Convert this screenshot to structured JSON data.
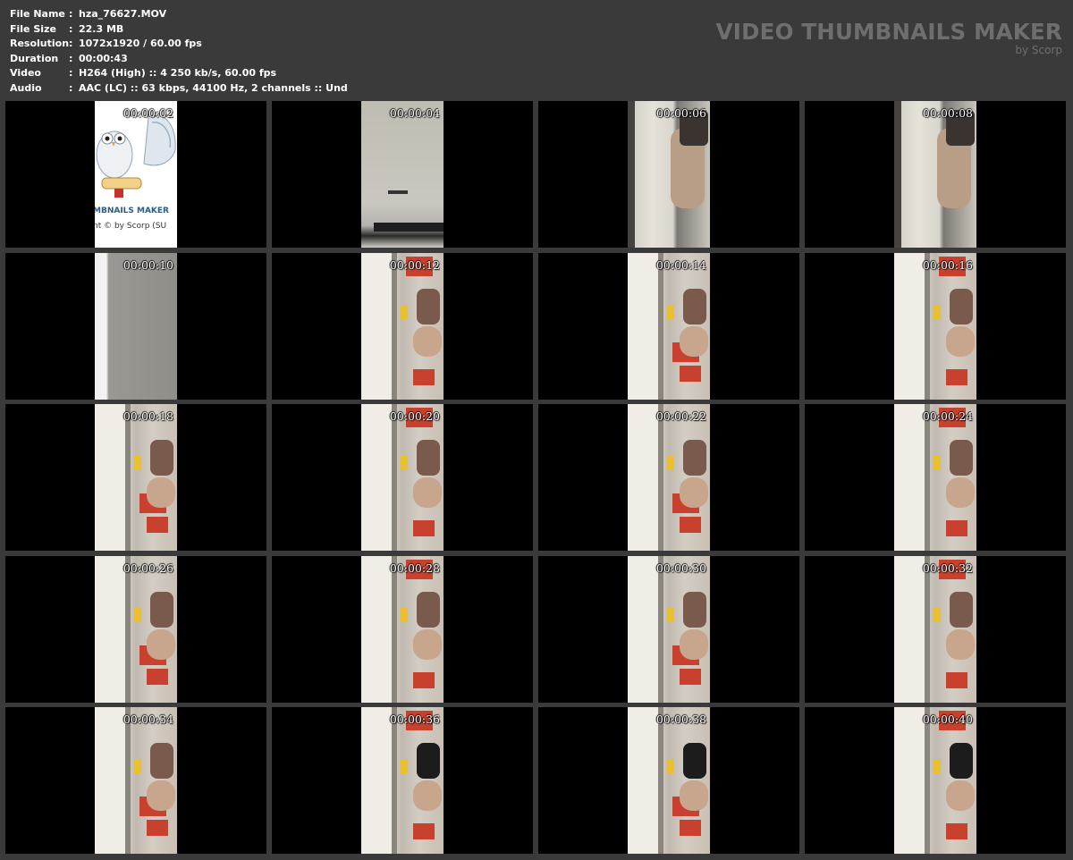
{
  "file_info": {
    "file_name": {
      "label": "File Name",
      "sep": ":",
      "value": "hza_76627.MOV"
    },
    "file_size": {
      "label": "File Size",
      "sep": ":",
      "value": "22.3 MB"
    },
    "resolution": {
      "label": "Resolution",
      "sep": ":",
      "value": "1072x1920 / 60.00 fps"
    },
    "duration": {
      "label": "Duration",
      "sep": ":",
      "value": "00:00:43"
    },
    "video": {
      "label": "Video",
      "sep": ":",
      "value": "H264 (High) :: 4 250 kb/s, 60.00 fps"
    },
    "audio": {
      "label": "Audio",
      "sep": ":",
      "value": "AAC (LC) :: 63 kbps, 44100 Hz, 2 channels :: Und"
    }
  },
  "brand": {
    "title": "VIDEO THUMBNAILS MAKER",
    "subtitle": "by Scorp"
  },
  "splash": {
    "text1": "MBNAILS MAKER",
    "text2": "nt © by Scorp (SU"
  },
  "thumbnails": [
    {
      "time": "00:00:02",
      "scene": "splash"
    },
    {
      "time": "00:00:04",
      "scene": "ceiling"
    },
    {
      "time": "00:00:06",
      "scene": "wall"
    },
    {
      "time": "00:00:08",
      "scene": "wall"
    },
    {
      "time": "00:00:10",
      "scene": "gray"
    },
    {
      "time": "00:00:12",
      "scene": "scene"
    },
    {
      "time": "00:00:14",
      "scene": "scene"
    },
    {
      "time": "00:00:16",
      "scene": "scene"
    },
    {
      "time": "00:00:18",
      "scene": "scene"
    },
    {
      "time": "00:00:20",
      "scene": "scene"
    },
    {
      "time": "00:00:22",
      "scene": "scene"
    },
    {
      "time": "00:00:24",
      "scene": "scene"
    },
    {
      "time": "00:00:26",
      "scene": "scene"
    },
    {
      "time": "00:00:28",
      "scene": "scene"
    },
    {
      "time": "00:00:30",
      "scene": "scene"
    },
    {
      "time": "00:00:32",
      "scene": "scene"
    },
    {
      "time": "00:00:34",
      "scene": "scene"
    },
    {
      "time": "00:00:36",
      "scene": "scene"
    },
    {
      "time": "00:00:38",
      "scene": "scene"
    },
    {
      "time": "00:00:40",
      "scene": "scene"
    }
  ],
  "colors": {
    "background": "#3a3a3a",
    "cell": "#000000",
    "header_text": "#ffffff",
    "brand_text": "#6e6e6e"
  }
}
